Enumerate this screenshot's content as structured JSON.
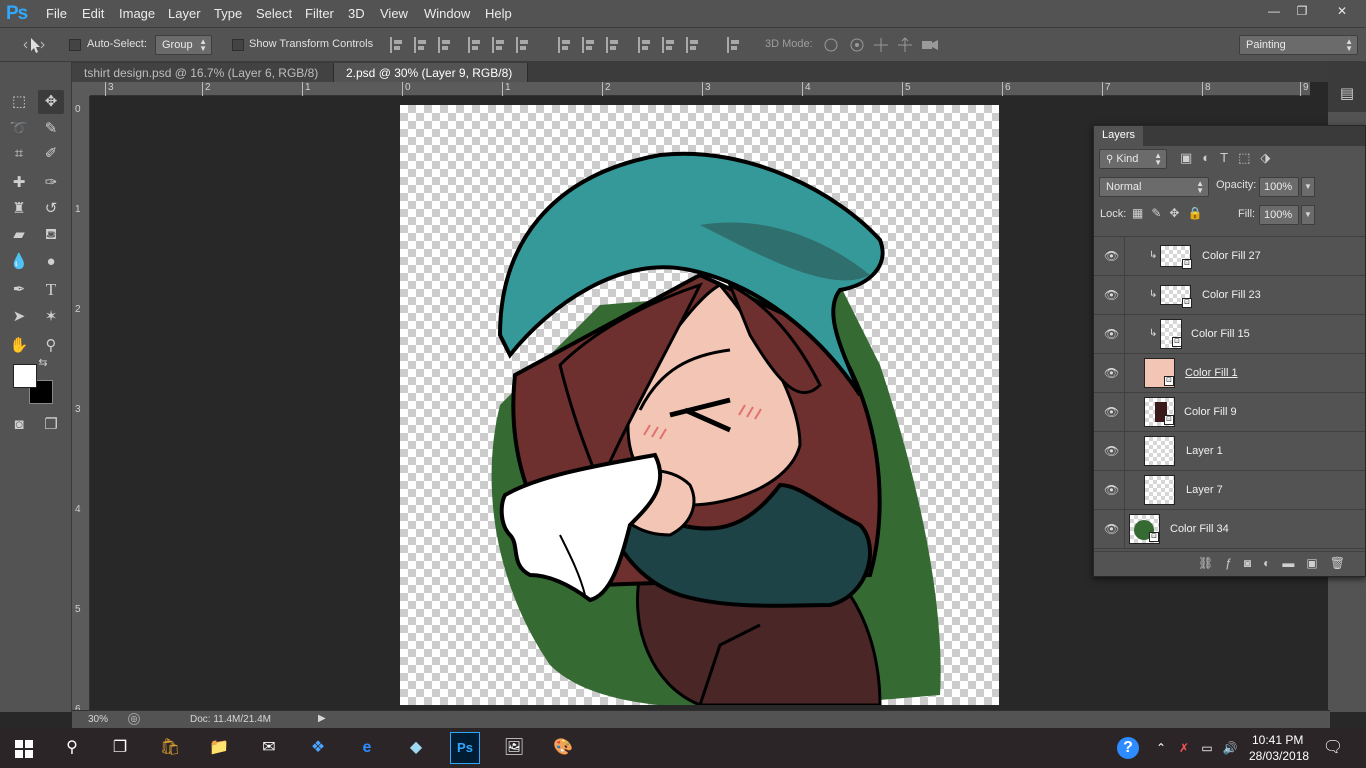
{
  "app": {
    "logo": "Ps"
  },
  "menu": [
    "File",
    "Edit",
    "Image",
    "Layer",
    "Type",
    "Select",
    "Filter",
    "3D",
    "View",
    "Window",
    "Help"
  ],
  "window_controls": {
    "minimize": "—",
    "restore": "❐",
    "close": "✕"
  },
  "options": {
    "auto_select_label": "Auto-Select:",
    "auto_select_value": "Group",
    "transform_label": "Show Transform Controls",
    "mode3d_label": "3D Mode:",
    "workspace": "Painting"
  },
  "tabs": [
    {
      "label": "tshirt design.psd @ 16.7% (Layer 6, RGB/8) *",
      "close": "✕"
    },
    {
      "label": "2.psd @ 30% (Layer 9, RGB/8) *",
      "close": "✕"
    }
  ],
  "ruler_h": [
    "3",
    "2",
    "1",
    "0",
    "1",
    "2",
    "3",
    "4",
    "5",
    "6",
    "7",
    "8",
    "9"
  ],
  "ruler_v": [
    "0",
    "1",
    "2",
    "3",
    "4",
    "5",
    "6"
  ],
  "layers": {
    "tab": "Layers",
    "kind": "Kind",
    "blend_mode": "Normal",
    "opacity_label": "Opacity:",
    "opacity": "100%",
    "lock_label": "Lock:",
    "fill_label": "Fill:",
    "fill": "100%",
    "rows": [
      {
        "name": "Color Fill 27",
        "clipped": true
      },
      {
        "name": "Color Fill 23",
        "clipped": true
      },
      {
        "name": "Color Fill 15",
        "clipped": true
      },
      {
        "name": "Color Fill 1",
        "clipped": false
      },
      {
        "name": "Color Fill 9",
        "clipped": false
      },
      {
        "name": "Layer 1",
        "clipped": false
      },
      {
        "name": "Layer 7",
        "clipped": false
      },
      {
        "name": "Color Fill 34",
        "clipped": false
      }
    ]
  },
  "status": {
    "zoom": "30%",
    "doc": "Doc: 11.4M/21.4M"
  },
  "taskbar": {
    "time": "10:41 PM",
    "date": "28/03/2018"
  },
  "colors": {
    "hat": "#35999a",
    "hat_shadow": "#2f6f6e",
    "hair": "#6e2f2f",
    "skin": "#f2c5b4",
    "sweater": "#1e4346",
    "background_blob": "#356b33",
    "scarf": "#4a2626"
  },
  "icons": {
    "move": "move-tool-icon",
    "search": "search-icon",
    "eye": "eye-icon"
  }
}
